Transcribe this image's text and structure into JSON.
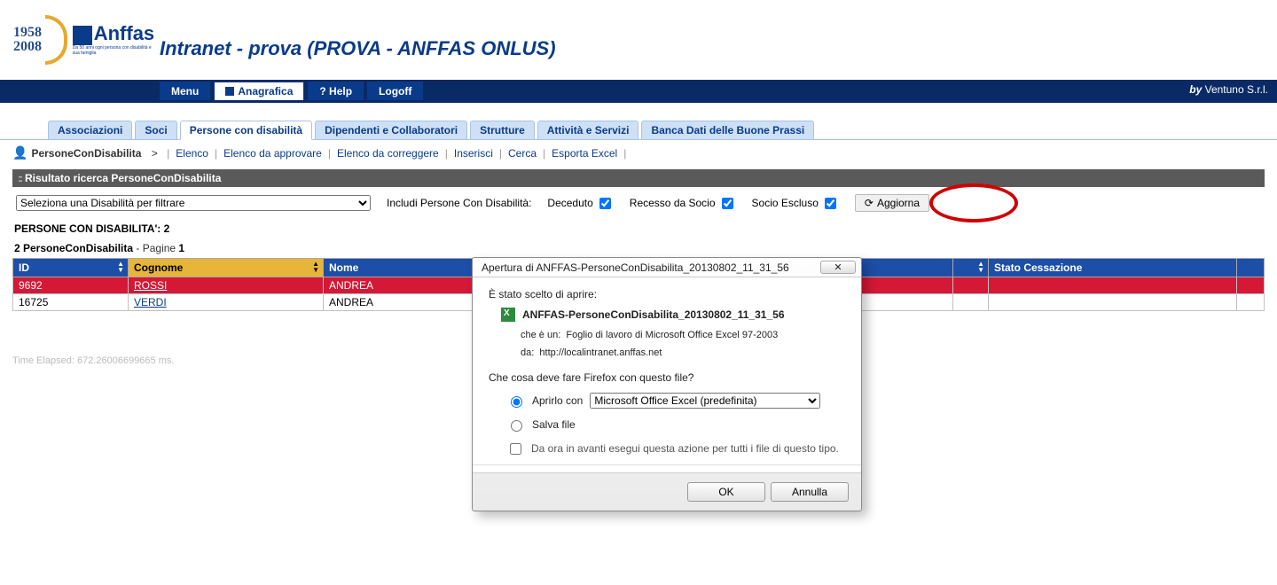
{
  "logo": {
    "year1": "1958",
    "year2": "2008",
    "brand": "Anffas",
    "tag": "Da 50 anni ogni persona con disabilità e sua famiglia"
  },
  "banner_title": "Intranet - prova (PROVA - ANFFAS ONLUS)",
  "nav": {
    "items": [
      {
        "label": "Menu"
      },
      {
        "label": "Anagrafica",
        "active": true,
        "icon": "document-icon"
      },
      {
        "label": "? Help"
      },
      {
        "label": "Logoff"
      }
    ],
    "credit_prefix": "by",
    "credit": "Ventuno S.r.l."
  },
  "sec_tabs": [
    {
      "label": "Associazioni"
    },
    {
      "label": "Soci"
    },
    {
      "label": "Persone con disabilità",
      "active": true
    },
    {
      "label": "Dipendenti e Collaboratori"
    },
    {
      "label": "Strutture"
    },
    {
      "label": "Attività e Servizi"
    },
    {
      "label": "Banca Dati delle Buone Prassi"
    }
  ],
  "subnav": {
    "title": "PersoneConDisabilita",
    "items": [
      "Elenco",
      "Elenco da approvare",
      "Elenco da correggere",
      "Inserisci",
      "Cerca",
      "Esporta Excel"
    ]
  },
  "panel": {
    "title": "Risultato ricerca PersoneConDisabilita",
    "filter_placeholder": "Seleziona una Disabilità per filtrare",
    "include_label": "Includi Persone Con Disabilità:",
    "chk_deceduto": "Deceduto",
    "chk_recesso": "Recesso da Socio",
    "chk_escluso": "Socio Escluso",
    "btn_aggiorna": "Aggiorna",
    "count_label": "PERSONE CON DISABILITA':",
    "count_value": "2",
    "pager_prefix": "2 PersoneConDisabilita",
    "pager_mid": " - Pagine ",
    "pager_page": "1"
  },
  "table": {
    "headers": [
      "ID",
      "Cognome",
      "Nome",
      "",
      "",
      "Stato Cessazione",
      ""
    ],
    "rows": [
      {
        "id": "9692",
        "cognome": "ROSSI",
        "nome": "ANDREA",
        "class": "row-red"
      },
      {
        "id": "16725",
        "cognome": "VERDI",
        "nome": "ANDREA",
        "class": "row-plain"
      }
    ]
  },
  "elapsed": "Time Elapsed: 672.26006699665 ms.",
  "dialog": {
    "title": "Apertura di ANFFAS-PersoneConDisabilita_20130802_11_31_56",
    "intro": "È stato scelto di aprire:",
    "filename": "ANFFAS-PersoneConDisabilita_20130802_11_31_56",
    "meta_type_label": "che è un:",
    "meta_type": "Foglio di lavoro di Microsoft Office Excel 97-2003",
    "meta_from_label": "da:",
    "meta_from": "http://localintranet.anffas.net",
    "question": "Che cosa deve fare Firefox con questo file?",
    "opt_open": "Aprirlo con",
    "opt_open_app": "Microsoft Office Excel (predefinita)",
    "opt_save": "Salva file",
    "remember": "Da ora in avanti esegui questa azione per tutti i file di questo tipo.",
    "ok": "OK",
    "cancel": "Annulla"
  }
}
